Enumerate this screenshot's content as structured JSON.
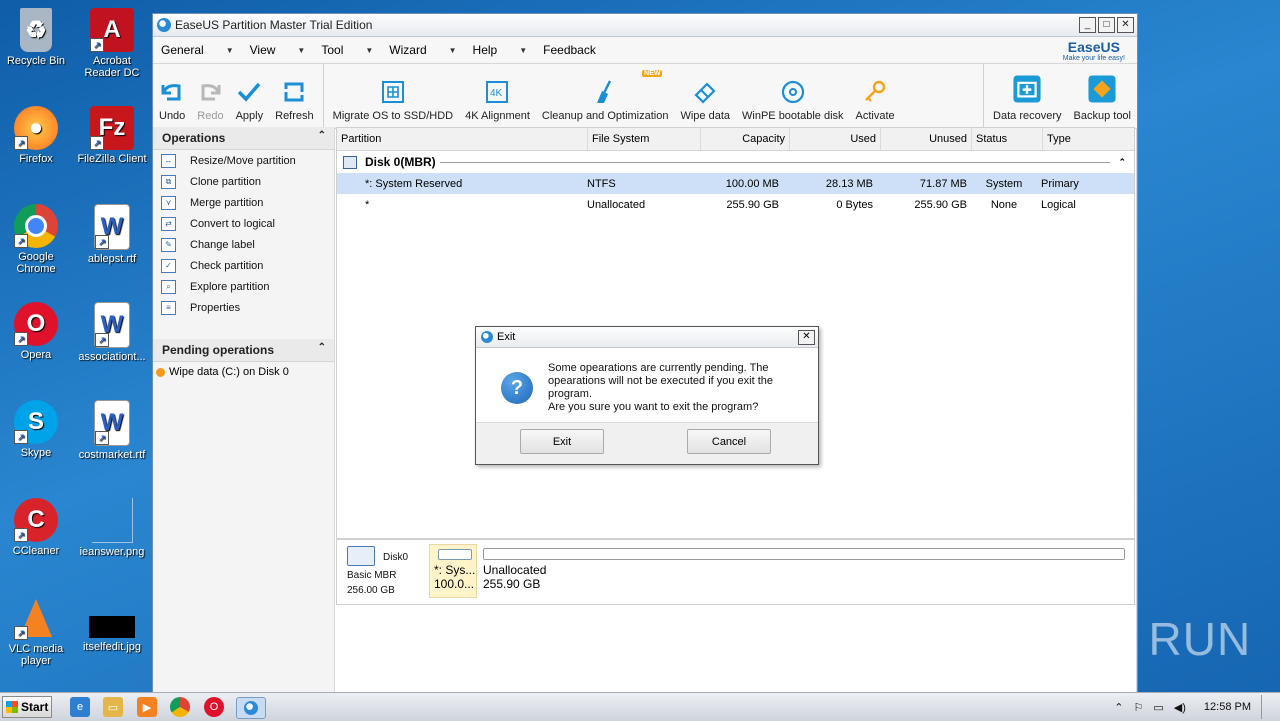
{
  "desktop": {
    "icons": [
      {
        "label": "Recycle Bin",
        "icon": "recycle-bin-icon",
        "color": "#9aa9b8"
      },
      {
        "label": "Acrobat Reader DC",
        "icon": "acrobat-icon",
        "color": "#c1121f"
      },
      {
        "label": "Firefox",
        "icon": "firefox-icon",
        "color": "#ff7a1a"
      },
      {
        "label": "FileZilla Client",
        "icon": "filezilla-icon",
        "color": "#c8161d"
      },
      {
        "label": "Google Chrome",
        "icon": "chrome-icon",
        "color": "#2f9e44"
      },
      {
        "label": "ablepst.rtf",
        "icon": "word-doc-icon",
        "color": "#2b5fbf"
      },
      {
        "label": "Opera",
        "icon": "opera-icon",
        "color": "#e0112b"
      },
      {
        "label": "associationt...",
        "icon": "word-doc-icon",
        "color": "#2b5fbf"
      },
      {
        "label": "Skype",
        "icon": "skype-icon",
        "color": "#00a2e8"
      },
      {
        "label": "costmarket.rtf",
        "icon": "word-doc-icon",
        "color": "#2b5fbf"
      },
      {
        "label": "CCleaner",
        "icon": "ccleaner-icon",
        "color": "#d8232a"
      },
      {
        "label": "ieanswer.png",
        "icon": "image-file-icon",
        "color": "#1666b2"
      },
      {
        "label": "VLC media player",
        "icon": "vlc-icon",
        "color": "#f58220"
      },
      {
        "label": "itselfedit.jpg",
        "icon": "image-file-icon",
        "color": "#000000"
      }
    ]
  },
  "window": {
    "title": "EaseUS Partition Master Trial Edition",
    "min": "_",
    "max": "□",
    "close": "✕",
    "menu": [
      "General",
      "View",
      "Tool",
      "Wizard",
      "Help",
      "Feedback"
    ],
    "brand_logo": "EaseUS",
    "brand_slogan": "Make your life easy!",
    "toolbar": {
      "undo": "Undo",
      "redo": "Redo",
      "apply": "Apply",
      "refresh": "Refresh",
      "migrate": "Migrate OS to SSD/HDD",
      "align": "4K Alignment",
      "cleanup": "Cleanup and Optimization",
      "cleanup_badge": "NEW",
      "wipe": "Wipe data",
      "winpe": "WinPE bootable disk",
      "activate": "Activate",
      "recovery": "Data recovery",
      "backup": "Backup tool"
    },
    "operations": {
      "title": "Operations",
      "items": [
        "Resize/Move partition",
        "Clone partition",
        "Merge partition",
        "Convert to logical",
        "Change label",
        "Check partition",
        "Explore partition",
        "Properties"
      ]
    },
    "pending": {
      "title": "Pending operations",
      "items": [
        "Wipe data (C:) on Disk 0"
      ]
    },
    "grid": {
      "columns": [
        "Partition",
        "File System",
        "Capacity",
        "Used",
        "Unused",
        "Status",
        "Type"
      ],
      "disk_label": "Disk 0(MBR)",
      "rows": [
        {
          "partition": "*: System Reserved",
          "fs": "NTFS",
          "capacity": "100.00 MB",
          "used": "28.13 MB",
          "unused": "71.87 MB",
          "status": "System",
          "type": "Primary"
        },
        {
          "partition": "*",
          "fs": "Unallocated",
          "capacity": "255.90 GB",
          "used": "0 Bytes",
          "unused": "255.90 GB",
          "status": "None",
          "type": "Logical"
        }
      ]
    },
    "diskmap": {
      "disk_name": "Disk0",
      "disk_type": "Basic MBR",
      "disk_size": "256.00 GB",
      "seg1_name": "*: Sys...",
      "seg1_size": "100.0...",
      "seg2_name": "Unallocated",
      "seg2_size": "255.90 GB"
    }
  },
  "dialog": {
    "title": "Exit",
    "close": "✕",
    "message_line1": "Some opearations are currently pending. The opearations will not be executed if you exit the program.",
    "message_line2": "Are you sure you want to exit the program?",
    "exit_label": "Exit",
    "cancel_label": "Cancel"
  },
  "taskbar": {
    "start": "Start",
    "clock": "12:58 PM"
  },
  "watermark": "ANY RUN"
}
